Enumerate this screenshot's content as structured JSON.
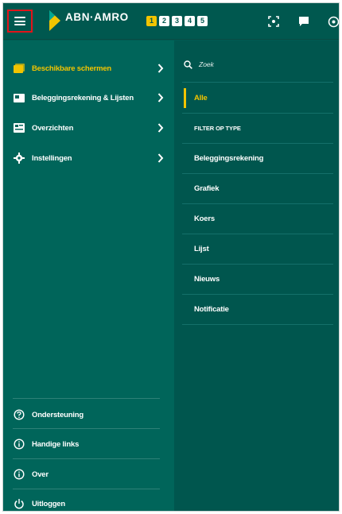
{
  "header": {
    "brand_name": "ABN·AMRO",
    "workspace_tabs": [
      "1",
      "2",
      "3",
      "4",
      "5"
    ],
    "active_workspace": "1",
    "icons": [
      "menu-icon",
      "screenshot-icon",
      "chat-icon",
      "close-circle-icon"
    ]
  },
  "left_menu": {
    "items": [
      {
        "label": "Beschikbare schermen",
        "icon": "screens-icon",
        "active": true
      },
      {
        "label": "Beleggingsrekening & Lijsten",
        "icon": "portfolio-icon",
        "active": false
      },
      {
        "label": "Overzichten",
        "icon": "overview-icon",
        "active": false
      },
      {
        "label": "Instellingen",
        "icon": "gear-icon",
        "active": false
      }
    ],
    "bottom_items": [
      {
        "label": "Ondersteuning",
        "icon": "help-icon"
      },
      {
        "label": "Handige links",
        "icon": "info-icon"
      },
      {
        "label": "Over",
        "icon": "info-icon"
      },
      {
        "label": "Uitloggen",
        "icon": "power-icon"
      }
    ]
  },
  "right_panel": {
    "search_placeholder": "Zoek",
    "all_label": "Alle",
    "filter_header": "FILTER OP TYPE",
    "types": [
      "Beleggingsrekening",
      "Grafiek",
      "Koers",
      "Lijst",
      "Nieuws",
      "Notificatie"
    ]
  },
  "colors": {
    "brand_green": "#005b52",
    "accent_yellow": "#f2c400",
    "highlight_red": "#e2141a"
  }
}
